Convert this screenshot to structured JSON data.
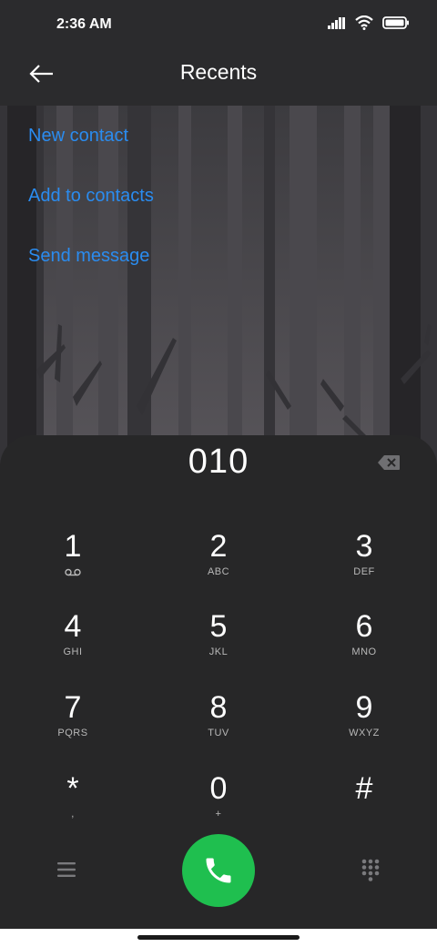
{
  "status_bar": {
    "time": "2:36 AM",
    "icons": [
      "signal-icon",
      "wifi-icon",
      "battery-icon"
    ]
  },
  "header": {
    "title": "Recents",
    "back_icon": "back-arrow-icon"
  },
  "actions": {
    "new_contact": "New contact",
    "add_to_contacts": "Add to contacts",
    "send_message": "Send message"
  },
  "dialpad": {
    "number": "010",
    "keys": [
      {
        "digit": "1",
        "sub": ""
      },
      {
        "digit": "2",
        "sub": "ABC"
      },
      {
        "digit": "3",
        "sub": "DEF"
      },
      {
        "digit": "4",
        "sub": "GHI"
      },
      {
        "digit": "5",
        "sub": "JKL"
      },
      {
        "digit": "6",
        "sub": "MNO"
      },
      {
        "digit": "7",
        "sub": "PQRS"
      },
      {
        "digit": "8",
        "sub": "TUV"
      },
      {
        "digit": "9",
        "sub": "WXYZ"
      },
      {
        "digit": "*",
        "sub": ","
      },
      {
        "digit": "0",
        "sub": "+"
      },
      {
        "digit": "#",
        "sub": ""
      }
    ]
  },
  "colors": {
    "link": "#2a8cf0",
    "call_button": "#1fbf4f",
    "background": "#2a2a2c"
  }
}
